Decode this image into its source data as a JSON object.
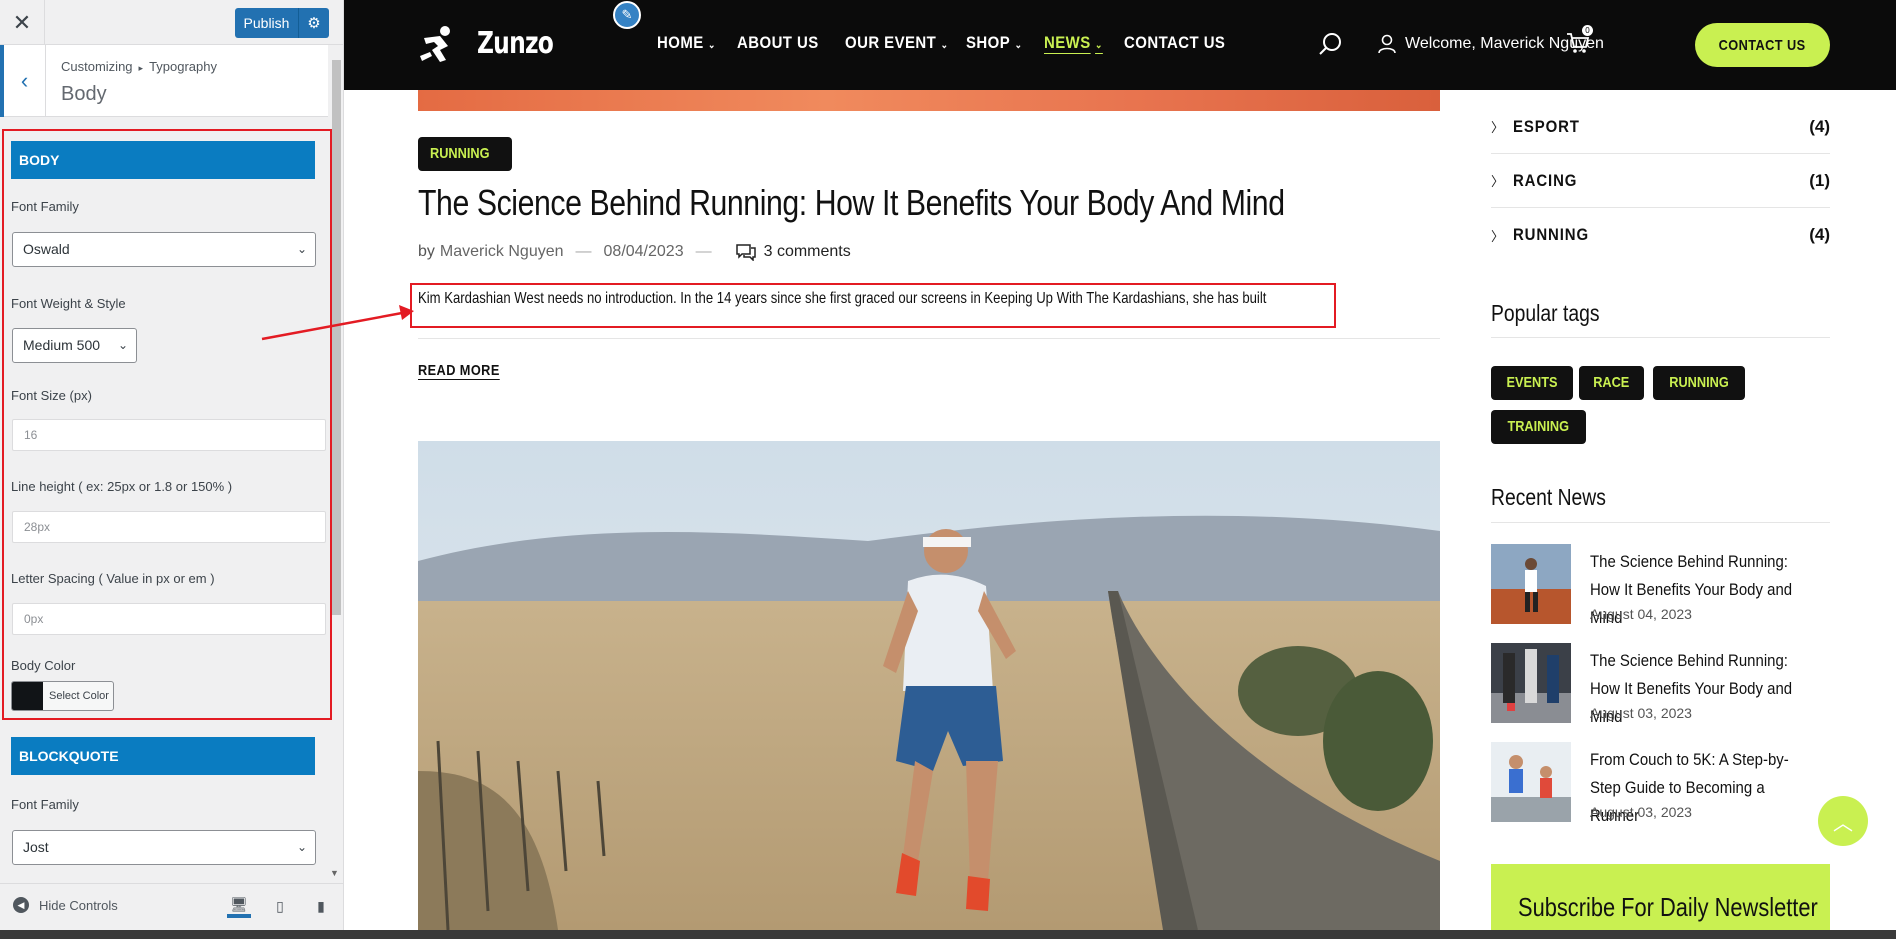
{
  "customizer": {
    "close_icon": "close-icon",
    "publish_label": "Publish",
    "breadcrumb_root": "Customizing",
    "breadcrumb_section": "Typography",
    "panel_title": "Body",
    "body_section": {
      "header": "BODY",
      "font_family_label": "Font Family",
      "font_family_value": "Oswald",
      "font_weight_label": "Font Weight & Style",
      "font_weight_value": "Medium 500",
      "font_size_label": "Font Size (px)",
      "font_size_value": "16",
      "line_height_label": "Line height ( ex: 25px or 1.8 or 150% )",
      "line_height_value": "28px",
      "letter_spacing_label": "Letter Spacing ( Value in px or em )",
      "letter_spacing_value": "0px",
      "color_label": "Body Color",
      "color_button_label": "Select Color",
      "color_value": "#111417"
    },
    "blockquote_section": {
      "header": "BLOCKQUOTE",
      "font_family_label": "Font Family",
      "font_family_value": "Jost"
    },
    "footer": {
      "hide_controls_label": "Hide Controls"
    }
  },
  "site": {
    "logo_text": "Zunzo",
    "nav": [
      {
        "label": "HOME",
        "has_dropdown": true
      },
      {
        "label": "ABOUT US",
        "has_dropdown": false
      },
      {
        "label": "OUR EVENT",
        "has_dropdown": true
      },
      {
        "label": "SHOP",
        "has_dropdown": true
      },
      {
        "label": "NEWS",
        "has_dropdown": true,
        "active": true
      },
      {
        "label": "CONTACT US",
        "has_dropdown": false
      }
    ],
    "welcome_text": "Welcome, Maverick Nguyen",
    "cart_count": "0",
    "contact_button": "CONTACT US",
    "accent_color": "#c9f051"
  },
  "post": {
    "category": "RUNNING",
    "title": "The Science Behind Running: How It Benefits Your Body And Mind",
    "by": "by",
    "author": "Maverick Nguyen",
    "date": "08/04/2023",
    "comments": "3 comments",
    "excerpt": "Kim Kardashian West needs no introduction. In the 14 years since she first graced our screens in Keeping Up With The Kardashians, she has built",
    "read_more": "READ MORE"
  },
  "sidebar_widgets": {
    "categories": [
      {
        "name": "ESPORT",
        "count": "(4)"
      },
      {
        "name": "RACING",
        "count": "(1)"
      },
      {
        "name": "RUNNING",
        "count": "(4)"
      }
    ],
    "popular_tags_title": "Popular tags",
    "tags": [
      "EVENTS",
      "RACE",
      "RUNNING",
      "TRAINING"
    ],
    "recent_news_title": "Recent News",
    "recent_news": [
      {
        "title": "The Science Behind Running: How It Benefits Your Body and Mind",
        "date": "August 04, 2023"
      },
      {
        "title": "The Science Behind Running: How It Benefits Your Body and Mind",
        "date": "August 03, 2023"
      },
      {
        "title": "From Couch to 5K: A Step-by-Step Guide to Becoming a Runner",
        "date": "August 03, 2023"
      }
    ],
    "newsletter_title": "Subscribe For Daily Newsletter"
  }
}
